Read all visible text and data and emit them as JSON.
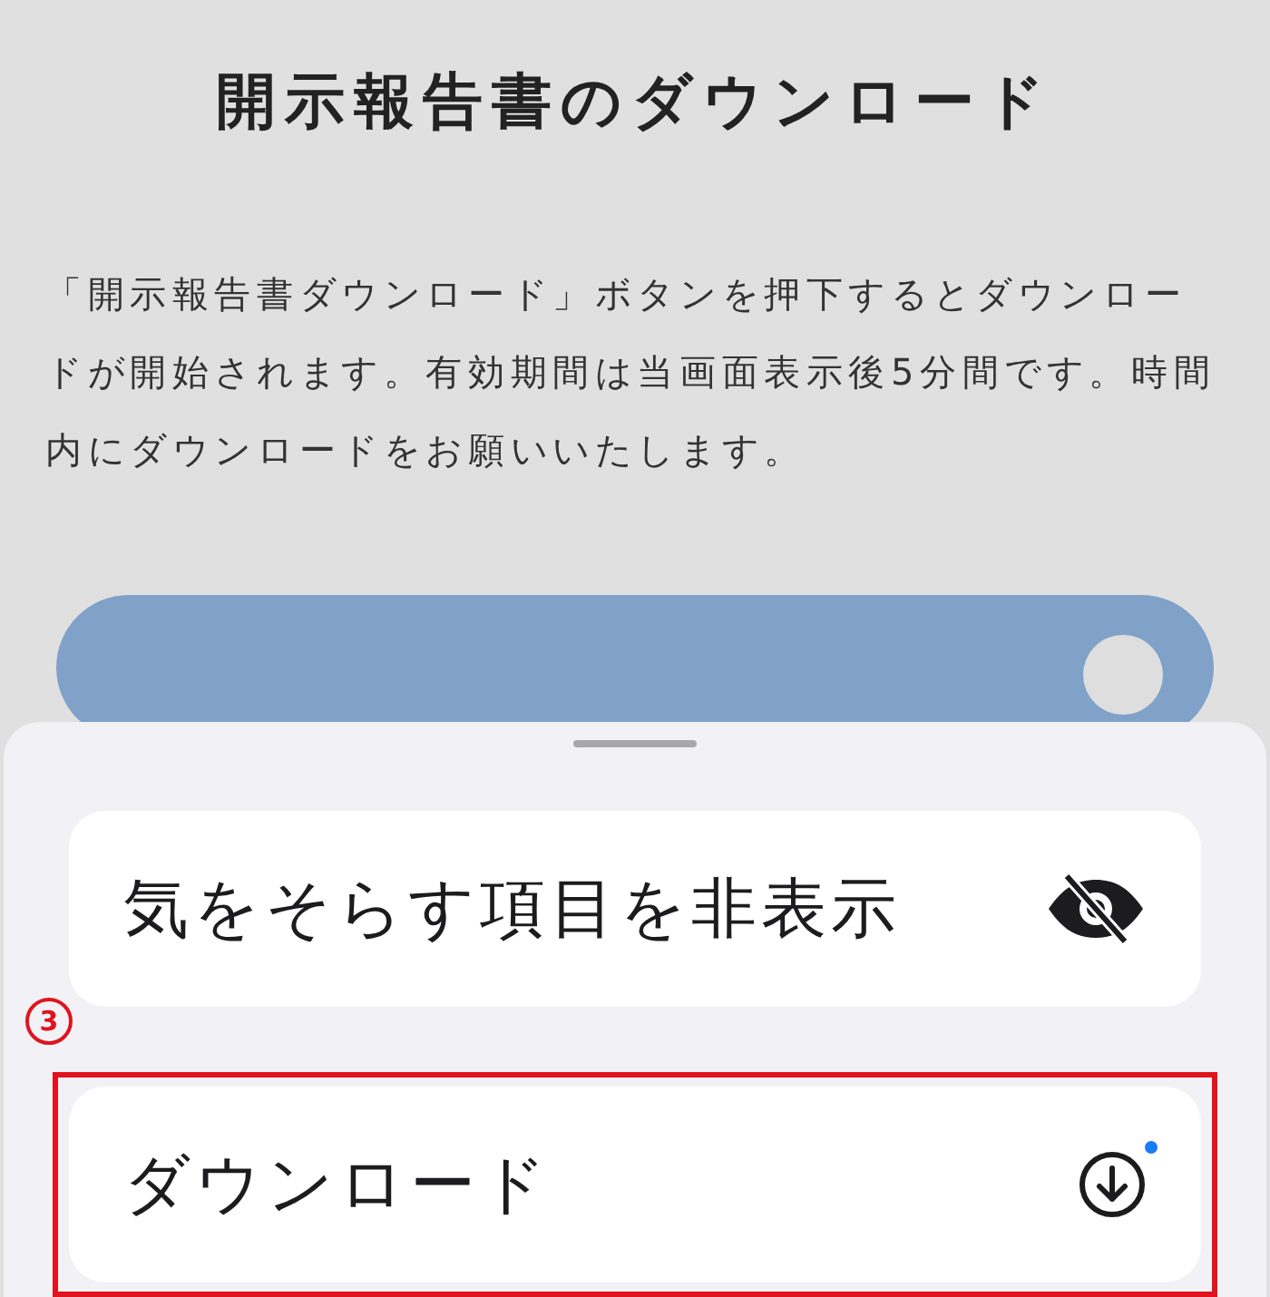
{
  "title": "開示報告書のダウンロード",
  "description": "「開示報告書ダウンロード」ボタンを押下するとダウンロードが開始されます。有効期間は当画面表示後5分間です。時間内にダウンロードをお願いいたします。",
  "sheet": {
    "items": [
      {
        "kind": "hide",
        "label": "気をそらす項目を非表示",
        "highlighted": false,
        "dot": false
      },
      {
        "kind": "download",
        "label": "ダウンロード",
        "highlighted": true,
        "dot": true,
        "step": "3"
      }
    ]
  }
}
